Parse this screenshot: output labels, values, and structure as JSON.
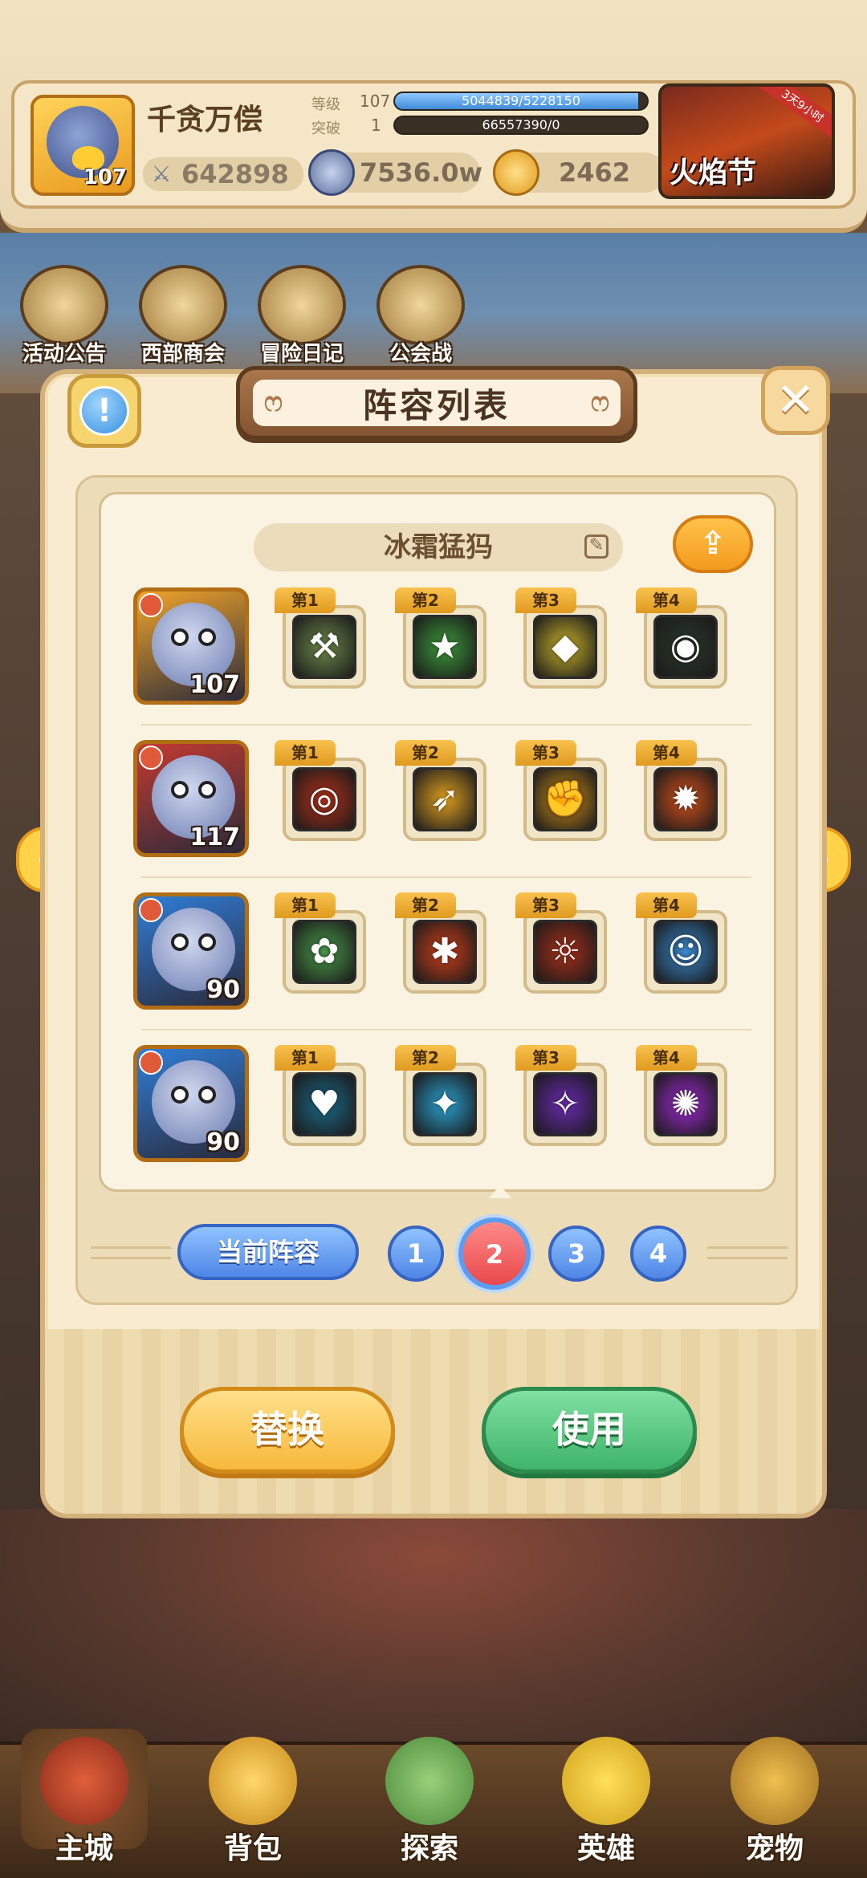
{
  "header": {
    "player_name": "千贪万偿",
    "player_level": "107",
    "power": "642898",
    "rank_label": "等级",
    "rank_num": "107",
    "rank_progress_text": "5044839/5228150",
    "rank_progress": 0.965,
    "break_label": "突破",
    "break_num": "1",
    "break_progress_text": "66557390/0",
    "break_progress": 0.0,
    "silver": "7536.0w",
    "gems": "2462",
    "event_label": "火焰节",
    "event_tag": "3天9小时"
  },
  "quick_links": [
    {
      "label": "活动公告",
      "icon": "notice-board-icon"
    },
    {
      "label": "西部商会",
      "icon": "merchant-icon"
    },
    {
      "label": "冒险日记",
      "icon": "diary-icon"
    },
    {
      "label": "公会战",
      "icon": "guild-war-icon"
    }
  ],
  "modal": {
    "title": "阵容列表",
    "lineup_name": "冰霜猛犸",
    "heroes": [
      {
        "level": "107",
        "portrait_color": "#f0a42a",
        "skills": [
          {
            "tag": "第1",
            "color": "#6d8a4a",
            "glyph": "⚒"
          },
          {
            "tag": "第2",
            "color": "#3c9a3a",
            "glyph": "★"
          },
          {
            "tag": "第3",
            "color": "#c7b02a",
            "glyph": "◆"
          },
          {
            "tag": "第4",
            "color": "#2a3a2a",
            "glyph": "◉"
          }
        ]
      },
      {
        "level": "117",
        "portrait_color": "#c43a30",
        "skills": [
          {
            "tag": "第1",
            "color": "#b4321a",
            "glyph": "◎"
          },
          {
            "tag": "第2",
            "color": "#e0a020",
            "glyph": "➶"
          },
          {
            "tag": "第3",
            "color": "#d0901a",
            "glyph": "✊"
          },
          {
            "tag": "第4",
            "color": "#d2501a",
            "glyph": "✹"
          }
        ]
      },
      {
        "level": "90",
        "portrait_color": "#2f7ed8",
        "skills": [
          {
            "tag": "第1",
            "color": "#4a9a4a",
            "glyph": "✿"
          },
          {
            "tag": "第2",
            "color": "#d0401a",
            "glyph": "✱"
          },
          {
            "tag": "第3",
            "color": "#a8301a",
            "glyph": "☼"
          },
          {
            "tag": "第4",
            "color": "#3a8ad0",
            "glyph": "☺"
          }
        ]
      },
      {
        "level": "90",
        "portrait_color": "#2f7ed8",
        "skills": [
          {
            "tag": "第1",
            "color": "#1a6a8a",
            "glyph": "♥"
          },
          {
            "tag": "第2",
            "color": "#2aa0d0",
            "glyph": "✦"
          },
          {
            "tag": "第3",
            "color": "#6a2ab0",
            "glyph": "✧"
          },
          {
            "tag": "第4",
            "color": "#a02ad0",
            "glyph": "✺"
          }
        ]
      }
    ],
    "current_lineup_label": "当前阵容",
    "pages": [
      "1",
      "2",
      "3",
      "4"
    ],
    "active_page": "2",
    "replace_label": "替换",
    "use_label": "使用"
  },
  "bottom_nav": [
    {
      "label": "主城",
      "active": true
    },
    {
      "label": "背包",
      "active": false
    },
    {
      "label": "探索",
      "active": false
    },
    {
      "label": "英雄",
      "active": false
    },
    {
      "label": "宠物",
      "active": false
    }
  ]
}
